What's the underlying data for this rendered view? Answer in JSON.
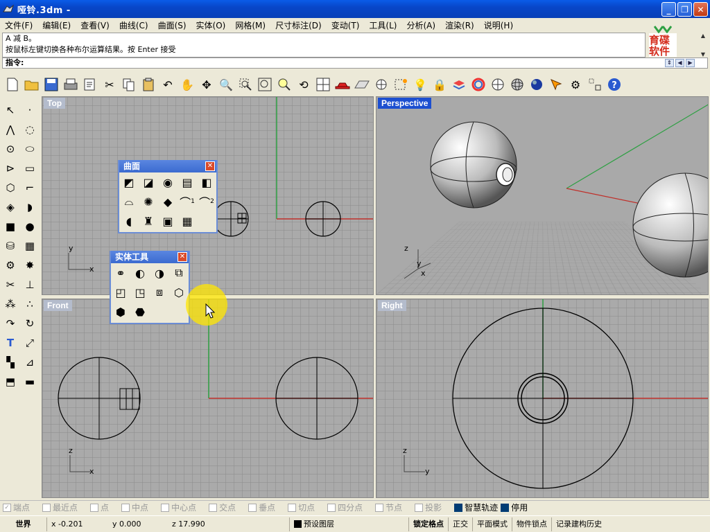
{
  "window": {
    "title": "哑铃.3dm -",
    "min": "_",
    "max": "❐",
    "close": "✕"
  },
  "menu": [
    "文件(F)",
    "编辑(E)",
    "查看(V)",
    "曲线(C)",
    "曲面(S)",
    "实体(O)",
    "网格(M)",
    "尺寸标注(D)",
    "变动(T)",
    "工具(L)",
    "分析(A)",
    "渲染(R)",
    "说明(H)"
  ],
  "history": {
    "line1": "A 减 B。",
    "line2": "按鼠标左键切换各种布尔运算结果。按 Enter 接受"
  },
  "command": {
    "prompt": "指令:",
    "value": ""
  },
  "logo": {
    "line1": "育碟",
    "line2": "软件"
  },
  "viewports": {
    "top": "Top",
    "perspective": "Perspective",
    "front": "Front",
    "right": "Right"
  },
  "axes": {
    "x": "x",
    "y": "y",
    "z": "z"
  },
  "panels": {
    "surface_title": "曲面",
    "solid_title": "实体工具",
    "close": "✕",
    "badge1": "1",
    "badge2": "2"
  },
  "osnaps": [
    {
      "label": "端点",
      "on": false
    },
    {
      "label": "最近点",
      "on": false
    },
    {
      "label": "点",
      "on": false
    },
    {
      "label": "中点",
      "on": false
    },
    {
      "label": "中心点",
      "on": false
    },
    {
      "label": "交点",
      "on": false
    },
    {
      "label": "垂点",
      "on": false
    },
    {
      "label": "切点",
      "on": false
    },
    {
      "label": "四分点",
      "on": false
    },
    {
      "label": "节点",
      "on": false
    },
    {
      "label": "投影",
      "on": false
    },
    {
      "label": "智慧轨迹",
      "on": true
    },
    {
      "label": "停用",
      "on": true
    }
  ],
  "status": {
    "cplane": "世界",
    "x": "x -0.201",
    "y": "y 0.000",
    "z": "z 17.990",
    "layer": "预设图层",
    "grid_snap": "锁定格点",
    "ortho": "正交",
    "planar": "平面模式",
    "osnap": "物件锁点",
    "history": "记录建构历史"
  },
  "colors": {
    "accent": "#0a5ce8",
    "viewport_bg": "#aaaaaa",
    "x_axis": "#c0302a",
    "y_axis": "#2ea043",
    "label_inactive": "#b4bccc",
    "label_active": "#1c4fd0"
  }
}
